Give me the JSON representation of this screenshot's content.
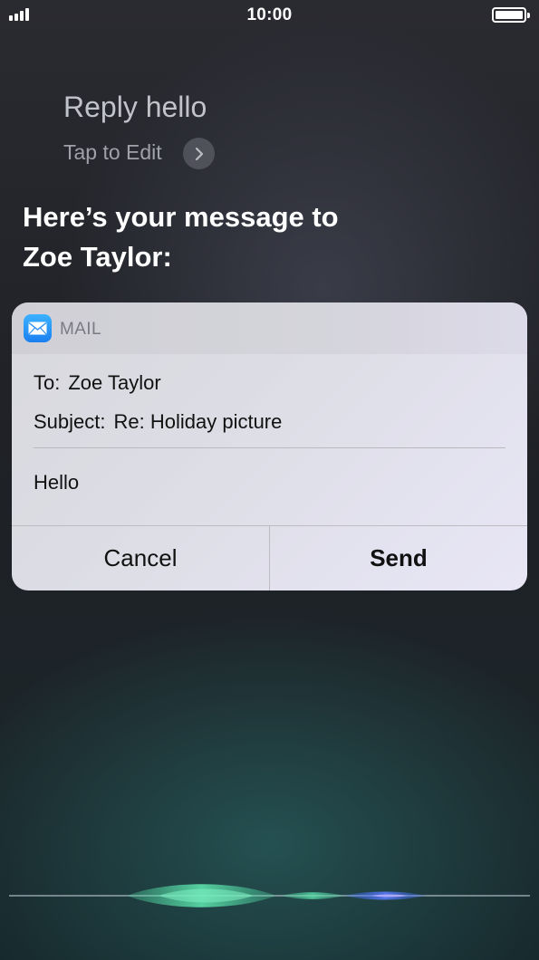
{
  "status_bar": {
    "time": "10:00",
    "signal_bars": 4,
    "battery_level": 1.0
  },
  "siri": {
    "query": "Reply hello",
    "tap_to_edit": "Tap to Edit",
    "response_line1": "Here’s your message to",
    "response_line2": "Zoe Taylor:"
  },
  "mail_card": {
    "app_name": "MAIL",
    "to_label": "To:",
    "to_value": "Zoe Taylor",
    "subject_label": "Subject:",
    "subject_value": "Re: Holiday picture",
    "body": "Hello",
    "cancel_label": "Cancel",
    "send_label": "Send"
  },
  "icons": {
    "app_icon": "mail-icon",
    "edit_chevron": "chevron-right-icon"
  },
  "colors": {
    "mail_icon_blue": "#1a7ff0",
    "card_background": "#dcdde4",
    "siri_wave_green": "#4fd6a0",
    "siri_wave_blue": "#3a6cff"
  }
}
